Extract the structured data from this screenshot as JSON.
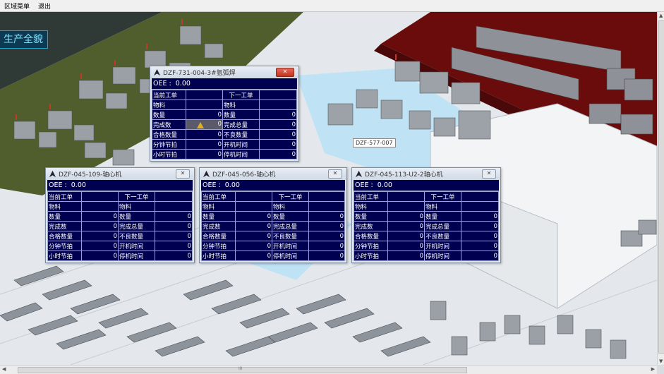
{
  "menu": {
    "items": [
      "区域菜单",
      "退出"
    ]
  },
  "scene": {
    "title": "生产全貌",
    "tooltip": "DZF-577-007"
  },
  "panel_labels": {
    "oee": "OEE :",
    "current_order": "当前工单",
    "next_order": "下一工单",
    "material": "物料",
    "left": [
      "数量",
      "完成数",
      "合格数量",
      "分钟节拍",
      "小时节拍"
    ],
    "right": [
      "数量",
      "完成总量",
      "不良数量",
      "开机时间",
      "停机时间"
    ]
  },
  "windows": [
    {
      "title": "DZF-731-004-3#氩弧焊",
      "oee": "0.00",
      "left_values": [
        "0",
        "0",
        "0",
        "0",
        "0"
      ],
      "right_values": [
        "0",
        "0",
        "0",
        "0",
        "0"
      ]
    },
    {
      "title": "DZF-045-109-轴心机",
      "oee": "0.00",
      "left_values": [
        "0",
        "0",
        "0",
        "0",
        "0"
      ],
      "right_values": [
        "0",
        "0",
        "0",
        "0",
        "0"
      ]
    },
    {
      "title": "DZF-045-056-轴心机",
      "oee": "0.00",
      "left_values": [
        "0",
        "0",
        "0",
        "0",
        "0"
      ],
      "right_values": [
        "0",
        "0",
        "0",
        "0",
        "0"
      ]
    },
    {
      "title": "DZF-045-113-U2-2轴心机",
      "oee": "0.00",
      "left_values": [
        "0",
        "0",
        "0",
        "0",
        "0"
      ],
      "right_values": [
        "0",
        "0",
        "0",
        "0",
        "0"
      ]
    }
  ],
  "scrollbar": {
    "grip": "III"
  },
  "colors": {
    "panel_bg": "#000050",
    "green_zone": "#4f5e2c",
    "red_zone": "#6a0c0c",
    "blue_zone": "#bfe3f5",
    "title_text": "#7fe3ff"
  }
}
